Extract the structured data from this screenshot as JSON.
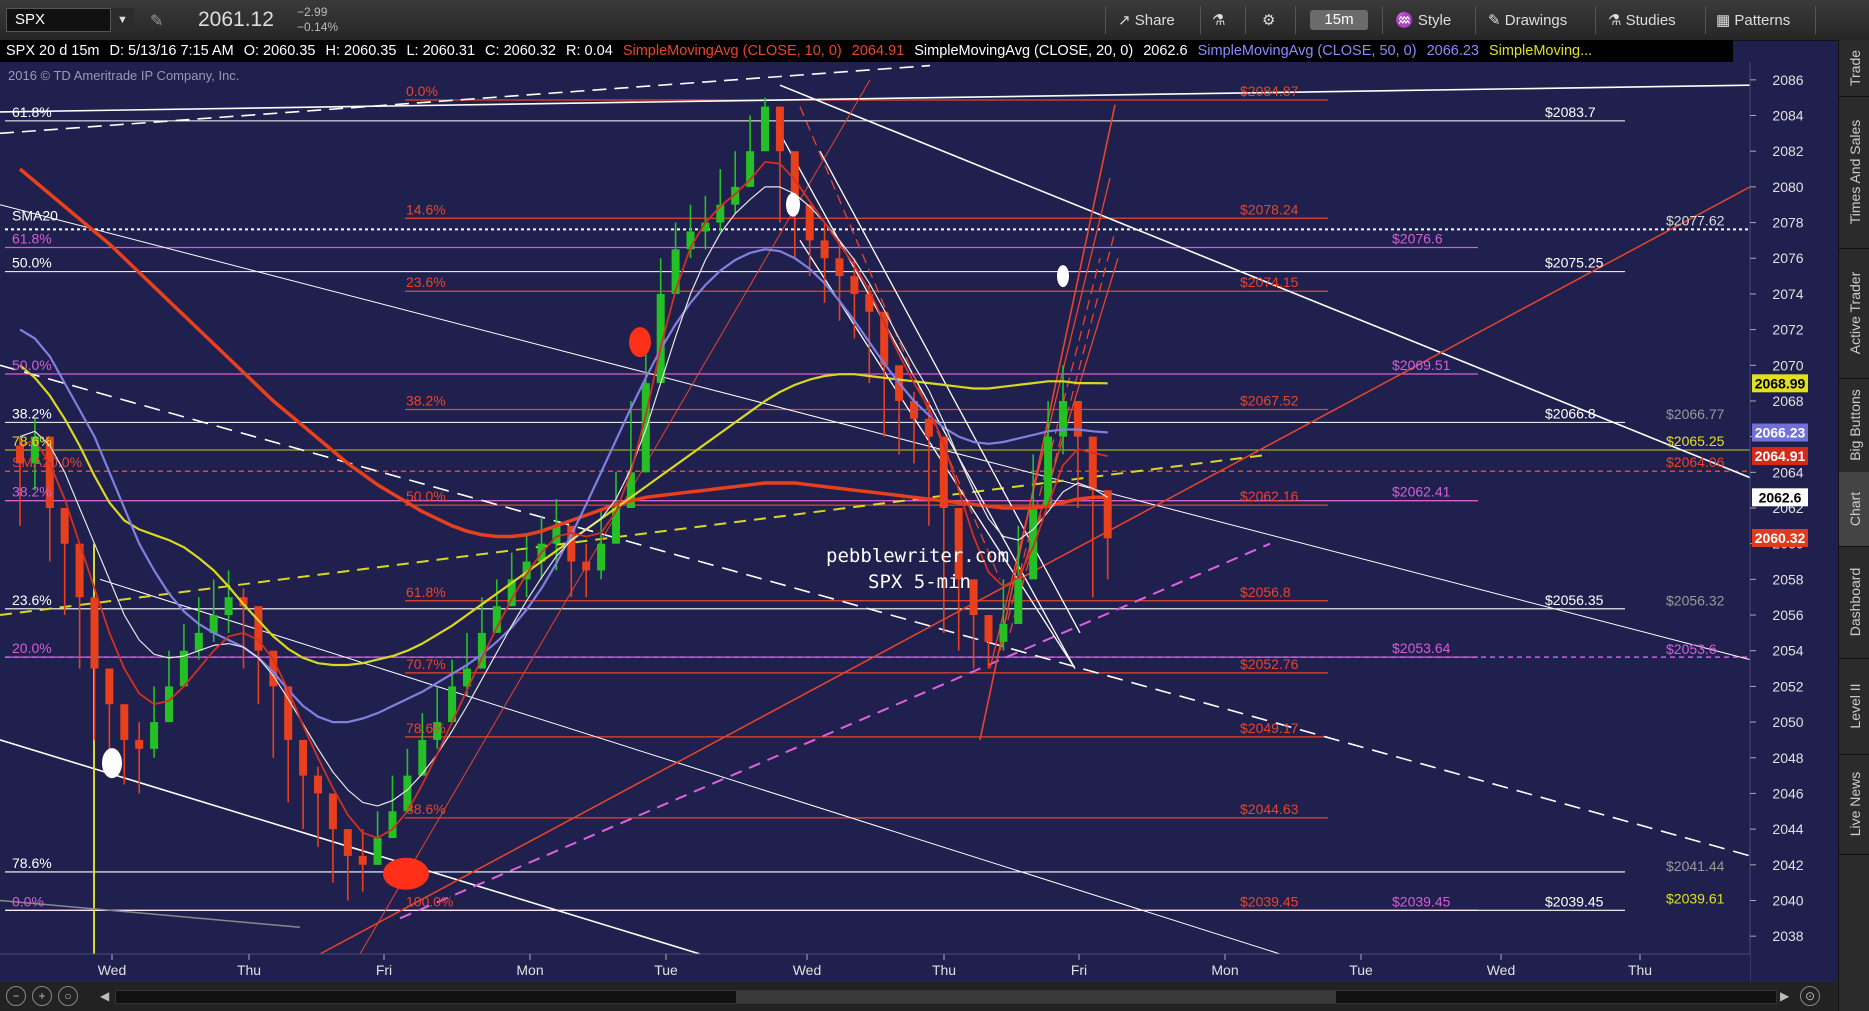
{
  "toolbar": {
    "symbol": "SPX",
    "last_price": "2061.12",
    "change": "−2.99",
    "change_pct": "−0.14%",
    "share": "Share",
    "interval": "15m",
    "style": "Style",
    "drawings": "Drawings",
    "studies": "Studies",
    "patterns": "Patterns"
  },
  "infobar": {
    "chart_desc": "SPX 20 d 15m",
    "date": "D: 5/13/16 7:15 AM",
    "open": "O: 2060.35",
    "high": "H: 2060.35",
    "low": "L: 2060.31",
    "close": "C: 2060.32",
    "range": "R: 0.04",
    "sma10_label": "SimpleMovingAvg (CLOSE, 10, 0)",
    "sma10_value": "2064.91",
    "sma20_label": "SimpleMovingAvg (CLOSE, 20, 0)",
    "sma20_value": "2062.6",
    "sma50_label": "SimpleMovingAvg (CLOSE, 50, 0)",
    "sma50_value": "2066.23",
    "sma_more": "SimpleMoving..."
  },
  "sidebar": [
    "Trade",
    "Times And Sales",
    "Active Trader",
    "Big Buttons",
    "Chart",
    "Dashboard",
    "Level II",
    "Live News"
  ],
  "sidebar_active": "Chart",
  "colors": {
    "background": "#20204e",
    "fib_red": "#e8452a",
    "fib_pink": "#d45fd4",
    "sma10": "#d23020",
    "sma20": "#e6e6e6",
    "sma50": "#8080e0",
    "sma_yellow": "#d8d820",
    "sma_orange": "#e8401c",
    "up_candle": "#25c025",
    "down_candle": "#e8401c",
    "white_line": "#ffffff"
  },
  "chart_data": {
    "type": "candlestick",
    "copyright": "2016 © TD Ameritrade IP Company, Inc.",
    "watermark": [
      "pebblewriter.com",
      "SPX 5-min"
    ],
    "x_labels": [
      "Wed",
      "Thu",
      "Fri",
      "Mon",
      "Tue",
      "Wed",
      "Thu",
      "Fri",
      "Mon",
      "Tue",
      "Wed",
      "Thu"
    ],
    "ylim": [
      2037,
      2087
    ],
    "y_ticks": [
      2038,
      2040,
      2042,
      2044,
      2046,
      2048,
      2050,
      2052,
      2054,
      2056,
      2058,
      2060,
      2062,
      2064,
      2066,
      2068,
      2070,
      2072,
      2074,
      2076,
      2078,
      2080,
      2082,
      2084,
      2086
    ],
    "fib_red_levels": [
      {
        "pct": "0.0%",
        "price": "$2084.87",
        "y": 2084.87
      },
      {
        "pct": "14.6%",
        "price": "$2078.24",
        "y": 2078.24
      },
      {
        "pct": "23.6%",
        "price": "$2074.15",
        "y": 2074.15
      },
      {
        "pct": "38.2%",
        "price": "$2067.52",
        "y": 2067.52
      },
      {
        "pct": "50.0%",
        "price": "$2062.16",
        "y": 2062.16
      },
      {
        "pct": "61.8%",
        "price": "$2056.8",
        "y": 2056.8
      },
      {
        "pct": "70.7%",
        "price": "$2052.76",
        "y": 2052.76
      },
      {
        "pct": "78.6%",
        "price": "$2049.17",
        "y": 2049.17
      },
      {
        "pct": "88.6%",
        "price": "$2044.63",
        "y": 2044.63
      },
      {
        "pct": "100.0%",
        "price": "$2039.45",
        "y": 2039.45
      }
    ],
    "fib_pink_levels": [
      {
        "pct": "61.8%",
        "price": "$2076.6",
        "y": 2076.6
      },
      {
        "pct": "50.0%",
        "price": "$2069.51",
        "y": 2069.51
      },
      {
        "pct": "38.2%",
        "price": "$2062.41",
        "y": 2062.41
      },
      {
        "pct": "20.0%",
        "price": "$2053.64",
        "y": 2053.64
      },
      {
        "pct": "0.0%",
        "price": "$2039.45",
        "y": 2039.45
      }
    ],
    "white_levels": [
      {
        "pct": "61.8%",
        "price": "$2083.7",
        "y": 2083.7
      },
      {
        "pct": "50.0%",
        "price": "$2075.25",
        "y": 2075.25
      },
      {
        "pct": "38.2%",
        "price": "$2066.8",
        "y": 2066.8
      },
      {
        "pct": "23.6%",
        "price": "$2056.35",
        "y": 2056.35
      },
      {
        "pct": "78.6%",
        "price": "",
        "y": 2041.6
      },
      {
        "pct": "",
        "price": "$2039.45",
        "y": 2039.45
      }
    ],
    "right_level_labels": [
      {
        "text": "$2077.62",
        "y": 2077.62,
        "color": "#dddddd"
      },
      {
        "text": "$2066.77",
        "y": 2066.77,
        "color": "#999999"
      },
      {
        "text": "$2065.25",
        "y": 2065.25,
        "color": "#e0e020"
      },
      {
        "text": "$2064.06",
        "y": 2064.06,
        "color": "#e8452a"
      },
      {
        "text": "$2056.32",
        "y": 2056.32,
        "color": "#999999"
      },
      {
        "text": "$2053.6",
        "y": 2053.6,
        "color": "#d45fd4"
      },
      {
        "text": "$2041.44",
        "y": 2041.44,
        "color": "#999999"
      },
      {
        "text": "$2039.61",
        "y": 2039.61,
        "color": "#e0e020"
      }
    ],
    "sma_labels": [
      {
        "text": "SMA20",
        "y": 2077.9
      },
      {
        "text": "78.6%",
        "y": 2065.25
      },
      {
        "text": "SMA20.0%",
        "y": 2064.06
      }
    ],
    "price_tags": [
      {
        "text": "2068.99",
        "y": 2068.99,
        "bg": "#e0e020",
        "fg": "#000000"
      },
      {
        "text": "2066.23",
        "y": 2066.23,
        "bg": "#7070d8",
        "fg": "#ffffff"
      },
      {
        "text": "2064.91",
        "y": 2064.91,
        "bg": "#d42a1a",
        "fg": "#ffffff"
      },
      {
        "text": "2062.6",
        "y": 2062.6,
        "bg": "#ffffff",
        "fg": "#000000"
      },
      {
        "text": "2060.32",
        "y": 2060.32,
        "bg": "#e23a1c",
        "fg": "#ffffff"
      }
    ],
    "series": {
      "close": [
        2064.5,
        2066,
        2062,
        2060,
        2057,
        2053,
        2051,
        2049,
        2048.5,
        2050,
        2052,
        2054,
        2055,
        2056,
        2057,
        2056.5,
        2054,
        2052,
        2049,
        2047,
        2046,
        2044,
        2042.5,
        2042,
        2043.5,
        2045,
        2047,
        2049,
        2050,
        2052,
        2053,
        2055,
        2056.5,
        2058,
        2059,
        2060,
        2061,
        2059,
        2058.5,
        2060,
        2062,
        2064,
        2069,
        2074,
        2076.5,
        2077.5,
        2078,
        2079,
        2080,
        2082,
        2084.5,
        2082,
        2079,
        2077,
        2076,
        2075,
        2074,
        2073,
        2070,
        2068,
        2067,
        2066,
        2062,
        2058,
        2056,
        2054.5,
        2055.5,
        2058,
        2062,
        2066,
        2068,
        2066,
        2063,
        2060.3
      ],
      "high": [
        2066,
        2067,
        2064,
        2061,
        2058.5,
        2055,
        2053,
        2051,
        2050,
        2052,
        2054,
        2055.5,
        2057,
        2058,
        2058.5,
        2057.5,
        2056,
        2053.5,
        2050.5,
        2049,
        2047.5,
        2045.5,
        2044,
        2044,
        2045,
        2047,
        2048.5,
        2050.5,
        2052,
        2053.5,
        2055,
        2057,
        2058,
        2059.5,
        2060.5,
        2061.5,
        2062.5,
        2061,
        2060,
        2062,
        2064,
        2068,
        2072,
        2076,
        2078,
        2079,
        2079.5,
        2081,
        2082,
        2084,
        2085,
        2084,
        2081,
        2079,
        2078,
        2077,
        2076,
        2074.5,
        2072,
        2069.5,
        2068.5,
        2068,
        2065,
        2060,
        2057.5,
        2056,
        2058,
        2061,
        2065,
        2068,
        2070,
        2068,
        2065,
        2061
      ],
      "low": [
        2061,
        2063,
        2059,
        2056,
        2053,
        2049,
        2047.5,
        2046.5,
        2046,
        2048,
        2050,
        2052.5,
        2053.5,
        2054.5,
        2055,
        2053,
        2051,
        2048,
        2045.5,
        2044,
        2043,
        2041,
        2040,
        2040.5,
        2042,
        2043.5,
        2045.5,
        2047,
        2048.5,
        2050.5,
        2051.5,
        2053.5,
        2055,
        2056.5,
        2057,
        2058,
        2058.5,
        2057,
        2057,
        2058,
        2060,
        2062.5,
        2064,
        2070,
        2074,
        2076,
        2076.5,
        2077.5,
        2078.5,
        2080,
        2082,
        2078,
        2076,
        2075,
        2073.5,
        2072.5,
        2071.5,
        2069,
        2066,
        2065,
        2064.5,
        2061,
        2055,
        2054,
        2053,
        2053,
        2054,
        2056,
        2060,
        2064,
        2065,
        2062,
        2057,
        2058
      ],
      "sma_orange": [
        2081,
        2080.3,
        2079.6,
        2078.9,
        2078.2,
        2077.5,
        2076.8,
        2076,
        2075.2,
        2074.4,
        2073.6,
        2072.8,
        2072,
        2071.2,
        2070.4,
        2069.6,
        2068.8,
        2068,
        2067.3,
        2066.6,
        2065.9,
        2065.2,
        2064.5,
        2063.9,
        2063.3,
        2062.8,
        2062.3,
        2061.8,
        2061.4,
        2061,
        2060.7,
        2060.5,
        2060.4,
        2060.4,
        2060.5,
        2060.7,
        2061,
        2061.3,
        2061.6,
        2061.9,
        2062.2,
        2062.4,
        2062.6,
        2062.7,
        2062.8,
        2062.9,
        2063,
        2063.1,
        2063.2,
        2063.3,
        2063.4,
        2063.4,
        2063.4,
        2063.3,
        2063.2,
        2063.1,
        2063,
        2062.9,
        2062.8,
        2062.7,
        2062.6,
        2062.5,
        2062.4,
        2062.3,
        2062.2,
        2062.1,
        2062,
        2062,
        2062,
        2062.1,
        2062.3,
        2062.5,
        2062.6,
        2062.6
      ],
      "sma_yellow": [
        2070,
        2069.3,
        2068.3,
        2067,
        2065.5,
        2063.8,
        2062.3,
        2061.3,
        2060.8,
        2060.5,
        2060.2,
        2059.8,
        2059.2,
        2058.5,
        2057.6,
        2056.6,
        2055.7,
        2054.8,
        2054.1,
        2053.6,
        2053.3,
        2053.2,
        2053.2,
        2053.3,
        2053.5,
        2053.7,
        2054,
        2054.4,
        2054.9,
        2055.4,
        2056,
        2056.6,
        2057.2,
        2057.8,
        2058.4,
        2059,
        2059.6,
        2060.2,
        2060.8,
        2061.4,
        2062,
        2062.6,
        2063.2,
        2063.8,
        2064.4,
        2065,
        2065.6,
        2066.2,
        2066.8,
        2067.4,
        2068,
        2068.5,
        2068.9,
        2069.2,
        2069.4,
        2069.5,
        2069.5,
        2069.4,
        2069.3,
        2069.2,
        2069.1,
        2069,
        2068.9,
        2068.8,
        2068.7,
        2068.7,
        2068.8,
        2068.9,
        2069,
        2069.1,
        2069.1,
        2069,
        2069,
        2068.99
      ],
      "sma50": [
        2072,
        2071.5,
        2070.5,
        2069,
        2067.5,
        2066,
        2064,
        2062,
        2060,
        2058.5,
        2057.2,
        2056.2,
        2055.5,
        2055,
        2054.6,
        2054.2,
        2053.6,
        2052.8,
        2051.8,
        2050.9,
        2050.3,
        2050,
        2050,
        2050.2,
        2050.5,
        2050.9,
        2051.3,
        2051.7,
        2052.2,
        2052.7,
        2053.2,
        2053.8,
        2054.5,
        2055.3,
        2056.3,
        2057.5,
        2058.9,
        2060.5,
        2062.2,
        2064,
        2065.8,
        2067.6,
        2069.3,
        2070.9,
        2072.3,
        2073.5,
        2074.5,
        2075.3,
        2075.9,
        2076.3,
        2076.5,
        2076.4,
        2076,
        2075.4,
        2074.6,
        2073.6,
        2072.5,
        2071.3,
        2070.1,
        2069,
        2068,
        2067.2,
        2066.5,
        2066,
        2065.7,
        2065.6,
        2065.7,
        2065.9,
        2066.1,
        2066.3,
        2066.4,
        2066.4,
        2066.3,
        2066.23
      ],
      "sma20": [
        2066,
        2066.3,
        2065.5,
        2064,
        2062,
        2060,
        2058,
        2056,
        2054.6,
        2053.8,
        2053.6,
        2053.7,
        2054,
        2054.3,
        2054.4,
        2054.2,
        2053.6,
        2052.6,
        2051.3,
        2049.9,
        2048.5,
        2047.2,
        2046.2,
        2045.5,
        2045.3,
        2045.6,
        2046.2,
        2047.1,
        2048.2,
        2049.5,
        2050.9,
        2052.4,
        2053.9,
        2055.4,
        2056.8,
        2058.1,
        2059.3,
        2060.2,
        2060.8,
        2061.4,
        2062.5,
        2064.2,
        2066.4,
        2069,
        2071.6,
        2074,
        2075.9,
        2077.4,
        2078.5,
        2079.3,
        2080,
        2080,
        2079.6,
        2078.9,
        2078,
        2077,
        2075.9,
        2074.6,
        2073.1,
        2071.5,
        2070,
        2068.6,
        2066.8,
        2064.8,
        2063,
        2061.4,
        2060.4,
        2060.2,
        2060.8,
        2061.8,
        2062.9,
        2063.4,
        2063.1,
        2062.6
      ],
      "sma10": [
        2065.5,
        2065.8,
        2064.5,
        2062.5,
        2060,
        2057.5,
        2055,
        2053,
        2051.6,
        2051,
        2051.2,
        2052,
        2053,
        2054,
        2054.8,
        2055,
        2054.6,
        2053.5,
        2051.8,
        2049.8,
        2048,
        2046.3,
        2044.8,
        2043.8,
        2043.5,
        2044,
        2045,
        2046.5,
        2048.2,
        2050,
        2051.8,
        2053.6,
        2055.3,
        2056.9,
        2058.3,
        2059.5,
        2060.4,
        2060.6,
        2060.4,
        2060.6,
        2061.8,
        2064,
        2067.2,
        2071,
        2074.2,
        2076.6,
        2078,
        2078.9,
        2079.6,
        2080.4,
        2081.4,
        2081.3,
        2080.4,
        2079.2,
        2078,
        2076.8,
        2075.6,
        2074.2,
        2072.4,
        2070.6,
        2069,
        2067.6,
        2065.6,
        2063,
        2060.4,
        2058.4,
        2057.6,
        2058.1,
        2059.8,
        2062.2,
        2064.4,
        2065.3,
        2065.1,
        2064.91
      ]
    }
  }
}
